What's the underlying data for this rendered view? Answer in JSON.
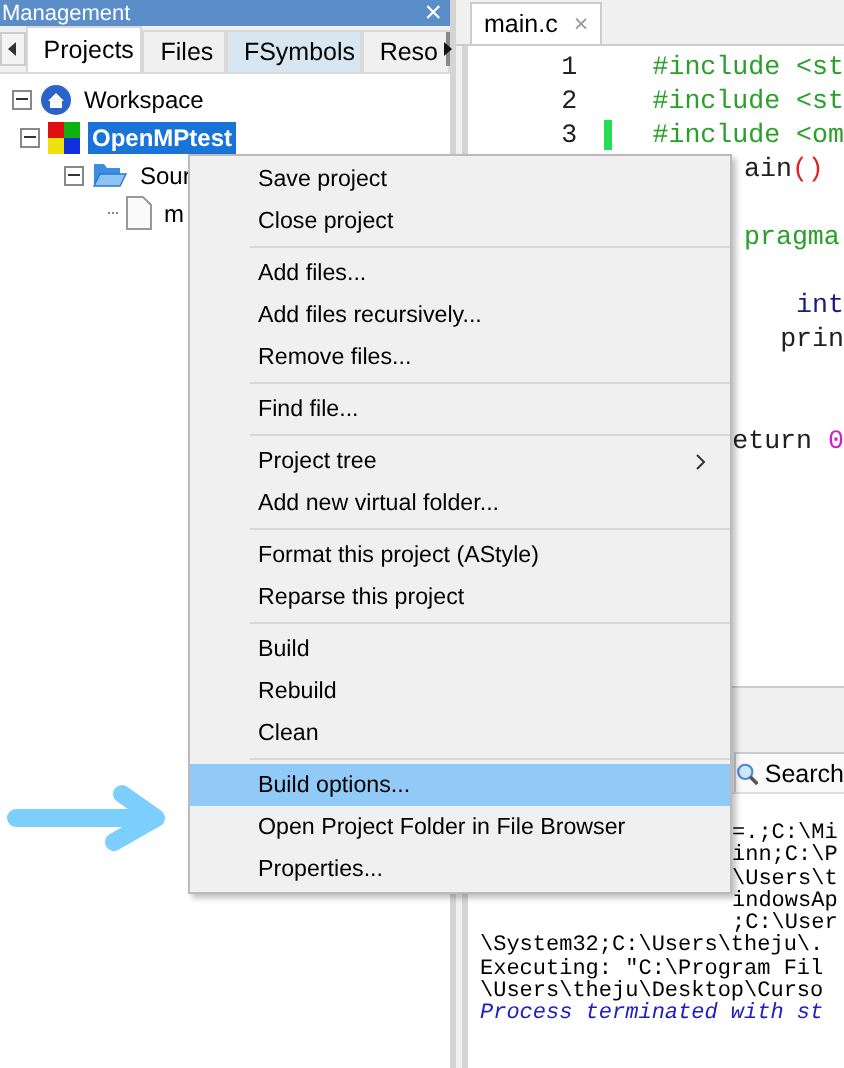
{
  "management": {
    "title": "Management",
    "close": "×",
    "tabs": [
      {
        "label": "Projects",
        "selected": true,
        "hover": false
      },
      {
        "label": "Files",
        "selected": false,
        "hover": false
      },
      {
        "label": "FSymbols",
        "selected": false,
        "hover": true
      },
      {
        "label": "Reso",
        "selected": false,
        "hover": false
      }
    ],
    "tree": [
      {
        "label": "Workspace",
        "kind": "workspace",
        "selected": false,
        "expanded": true,
        "children": [
          {
            "label": "OpenMPtest",
            "kind": "project",
            "selected": true,
            "expanded": true,
            "children": [
              {
                "label": "Sour",
                "kind": "folder",
                "selected": false,
                "expanded": true,
                "children": [
                  {
                    "label": "m",
                    "kind": "file",
                    "selected": false
                  }
                ]
              }
            ]
          }
        ]
      }
    ]
  },
  "editor": {
    "tab": {
      "label": "main.c",
      "close": "×"
    },
    "lines": [
      {
        "number": "1",
        "kind": "full",
        "tokens": [
          {
            "text": "#include <st",
            "kind": "preproc"
          }
        ]
      },
      {
        "number": "2",
        "kind": "full",
        "tokens": [
          {
            "text": "#include <st",
            "kind": "preproc"
          }
        ]
      },
      {
        "number": "3",
        "kind": "full",
        "marked": true,
        "tokens": [
          {
            "text": "#include <om",
            "kind": "preproc"
          }
        ]
      },
      {
        "kind": "cut",
        "tokens": [
          {
            "text": "ain",
            "kind": "plain"
          },
          {
            "text": "()",
            "kind": "paren"
          }
        ]
      },
      {
        "kind": "blank"
      },
      {
        "kind": "cut",
        "tokens": [
          {
            "text": "pragma",
            "kind": "preproc"
          }
        ]
      },
      {
        "kind": "blank"
      },
      {
        "kind": "nested",
        "tokens": [
          {
            "text": "int",
            "kind": "keyword"
          }
        ]
      },
      {
        "kind": "nested",
        "tokens": [
          {
            "text": "prin",
            "kind": "plain"
          }
        ]
      },
      {
        "kind": "blank"
      },
      {
        "kind": "blank"
      },
      {
        "kind": "cut",
        "tokens": [
          {
            "text": "eturn ",
            "kind": "plain"
          },
          {
            "text": "0",
            "kind": "number"
          }
        ]
      }
    ]
  },
  "log": {
    "tab": "Search",
    "lines": [
      {
        "text": "=.;C:\\Mi",
        "kind": "cut"
      },
      {
        "text": "inn;C:\\P",
        "kind": "cut"
      },
      {
        "text": "\\Users\\t",
        "kind": "cut"
      },
      {
        "text": "indowsAp",
        "kind": "cut"
      },
      {
        "text": ";C:\\User",
        "kind": "cut"
      },
      {
        "text": "\\System32;C:\\Users\\theju\\.",
        "kind": "full"
      },
      {
        "text": "Executing: \"C:\\Program Fil",
        "kind": "full"
      },
      {
        "text": "\\Users\\theju\\Desktop\\Curso",
        "kind": "full"
      },
      {
        "text": "Process terminated with st",
        "kind": "status"
      }
    ]
  },
  "context_menu": {
    "items": [
      {
        "label": "Save project",
        "kind": "item",
        "selected": false
      },
      {
        "label": "Close project",
        "kind": "item",
        "selected": false
      },
      {
        "kind": "separator"
      },
      {
        "label": "Add files...",
        "kind": "item",
        "selected": false
      },
      {
        "label": "Add files recursively...",
        "kind": "item",
        "selected": false
      },
      {
        "label": "Remove files...",
        "kind": "item",
        "selected": false
      },
      {
        "kind": "separator"
      },
      {
        "label": "Find file...",
        "kind": "item",
        "selected": false
      },
      {
        "kind": "separator"
      },
      {
        "label": "Project tree",
        "kind": "submenu",
        "selected": false
      },
      {
        "label": "Add new virtual folder...",
        "kind": "item",
        "selected": false
      },
      {
        "kind": "separator"
      },
      {
        "label": "Format this project (AStyle)",
        "kind": "item",
        "selected": false
      },
      {
        "label": "Reparse this project",
        "kind": "item",
        "selected": false
      },
      {
        "kind": "separator"
      },
      {
        "label": "Build",
        "kind": "item",
        "selected": false
      },
      {
        "label": "Rebuild",
        "kind": "item",
        "selected": false
      },
      {
        "label": "Clean",
        "kind": "item",
        "selected": false
      },
      {
        "kind": "separator"
      },
      {
        "label": "Build options...",
        "kind": "item",
        "selected": true
      },
      {
        "label": "Open Project Folder in File Browser",
        "kind": "item",
        "selected": false
      },
      {
        "label": "Properties...",
        "kind": "item",
        "selected": false
      }
    ]
  }
}
